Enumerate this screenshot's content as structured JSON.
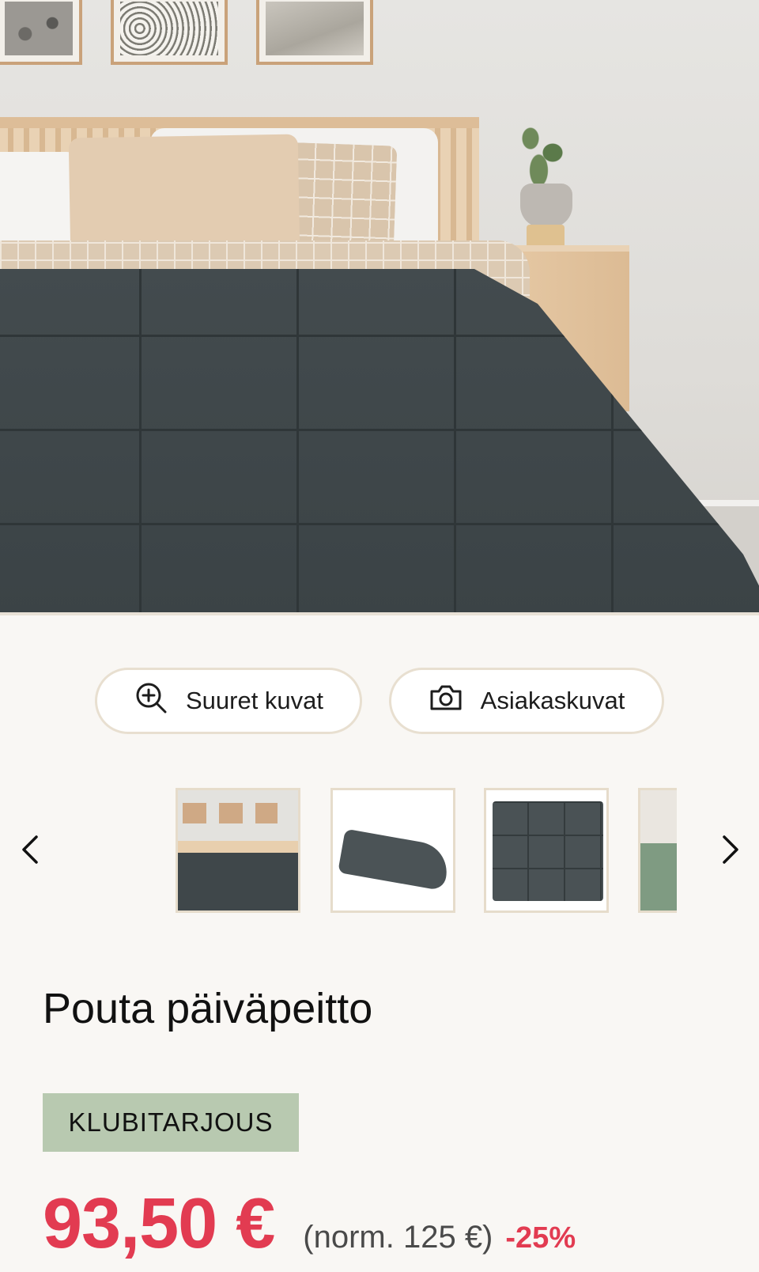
{
  "actions": {
    "zoom_label": "Suuret kuvat",
    "customer_photos_label": "Asiakaskuvat"
  },
  "gallery": {
    "thumbnail_count_visible": 4,
    "selected_index": 0
  },
  "product": {
    "title": "Pouta päiväpeitto",
    "badge": "KLUBITARJOUS",
    "price": "93,50 €",
    "normal_price": "(norm. 125 €)",
    "discount": "-25%"
  },
  "colors": {
    "accent_red": "#e23b51",
    "badge_green": "#b8c9b0",
    "background": "#f9f7f4",
    "pill_border": "#e8dfd0"
  },
  "icons": [
    "zoom-in-icon",
    "camera-icon",
    "chevron-left-icon",
    "chevron-right-icon"
  ]
}
